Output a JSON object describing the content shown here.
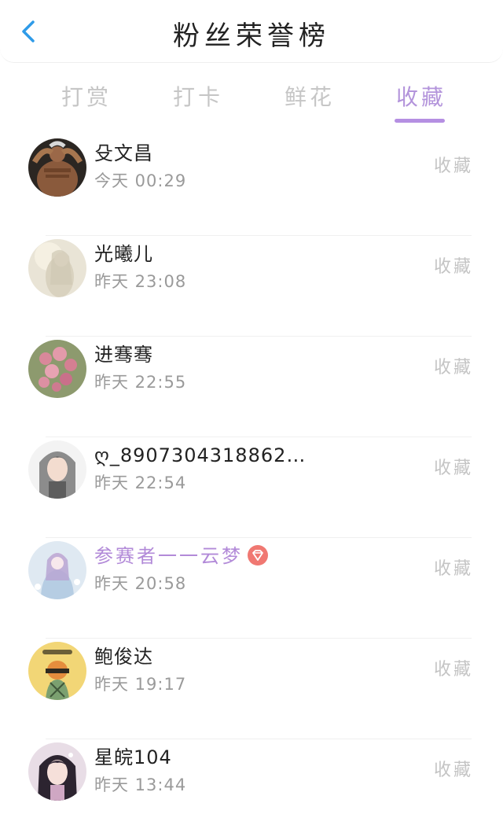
{
  "header": {
    "title": "粉丝荣誉榜",
    "back_icon": "chevron-left-icon",
    "accent": "#2f9be8"
  },
  "tabs": [
    {
      "label": "打赏",
      "active": false
    },
    {
      "label": "打卡",
      "active": false
    },
    {
      "label": "鲜花",
      "active": false
    },
    {
      "label": "收藏",
      "active": true
    }
  ],
  "colors": {
    "active_tab": "#b394db",
    "underline": "#b58fe2",
    "vip_name": "#b28ad8",
    "badge": "#f07872"
  },
  "fans": [
    {
      "name": "殳文昌",
      "time": "今天 00:29",
      "action": "收藏",
      "vip": false
    },
    {
      "name": "光曦儿",
      "time": "昨天 23:08",
      "action": "收藏",
      "vip": false
    },
    {
      "name": "进骞骞",
      "time": "昨天 22:55",
      "action": "收藏",
      "vip": false
    },
    {
      "name": "ღ_8907304318862…",
      "time": "昨天 22:54",
      "action": "收藏",
      "vip": false
    },
    {
      "name": "参赛者一一云梦",
      "time": "昨天 20:58",
      "action": "收藏",
      "vip": true,
      "badge_icon": "diamond-badge-icon"
    },
    {
      "name": "鲍俊达",
      "time": "昨天 19:17",
      "action": "收藏",
      "vip": false
    },
    {
      "name": "星皖104",
      "time": "昨天 13:44",
      "action": "收藏",
      "vip": false
    }
  ]
}
